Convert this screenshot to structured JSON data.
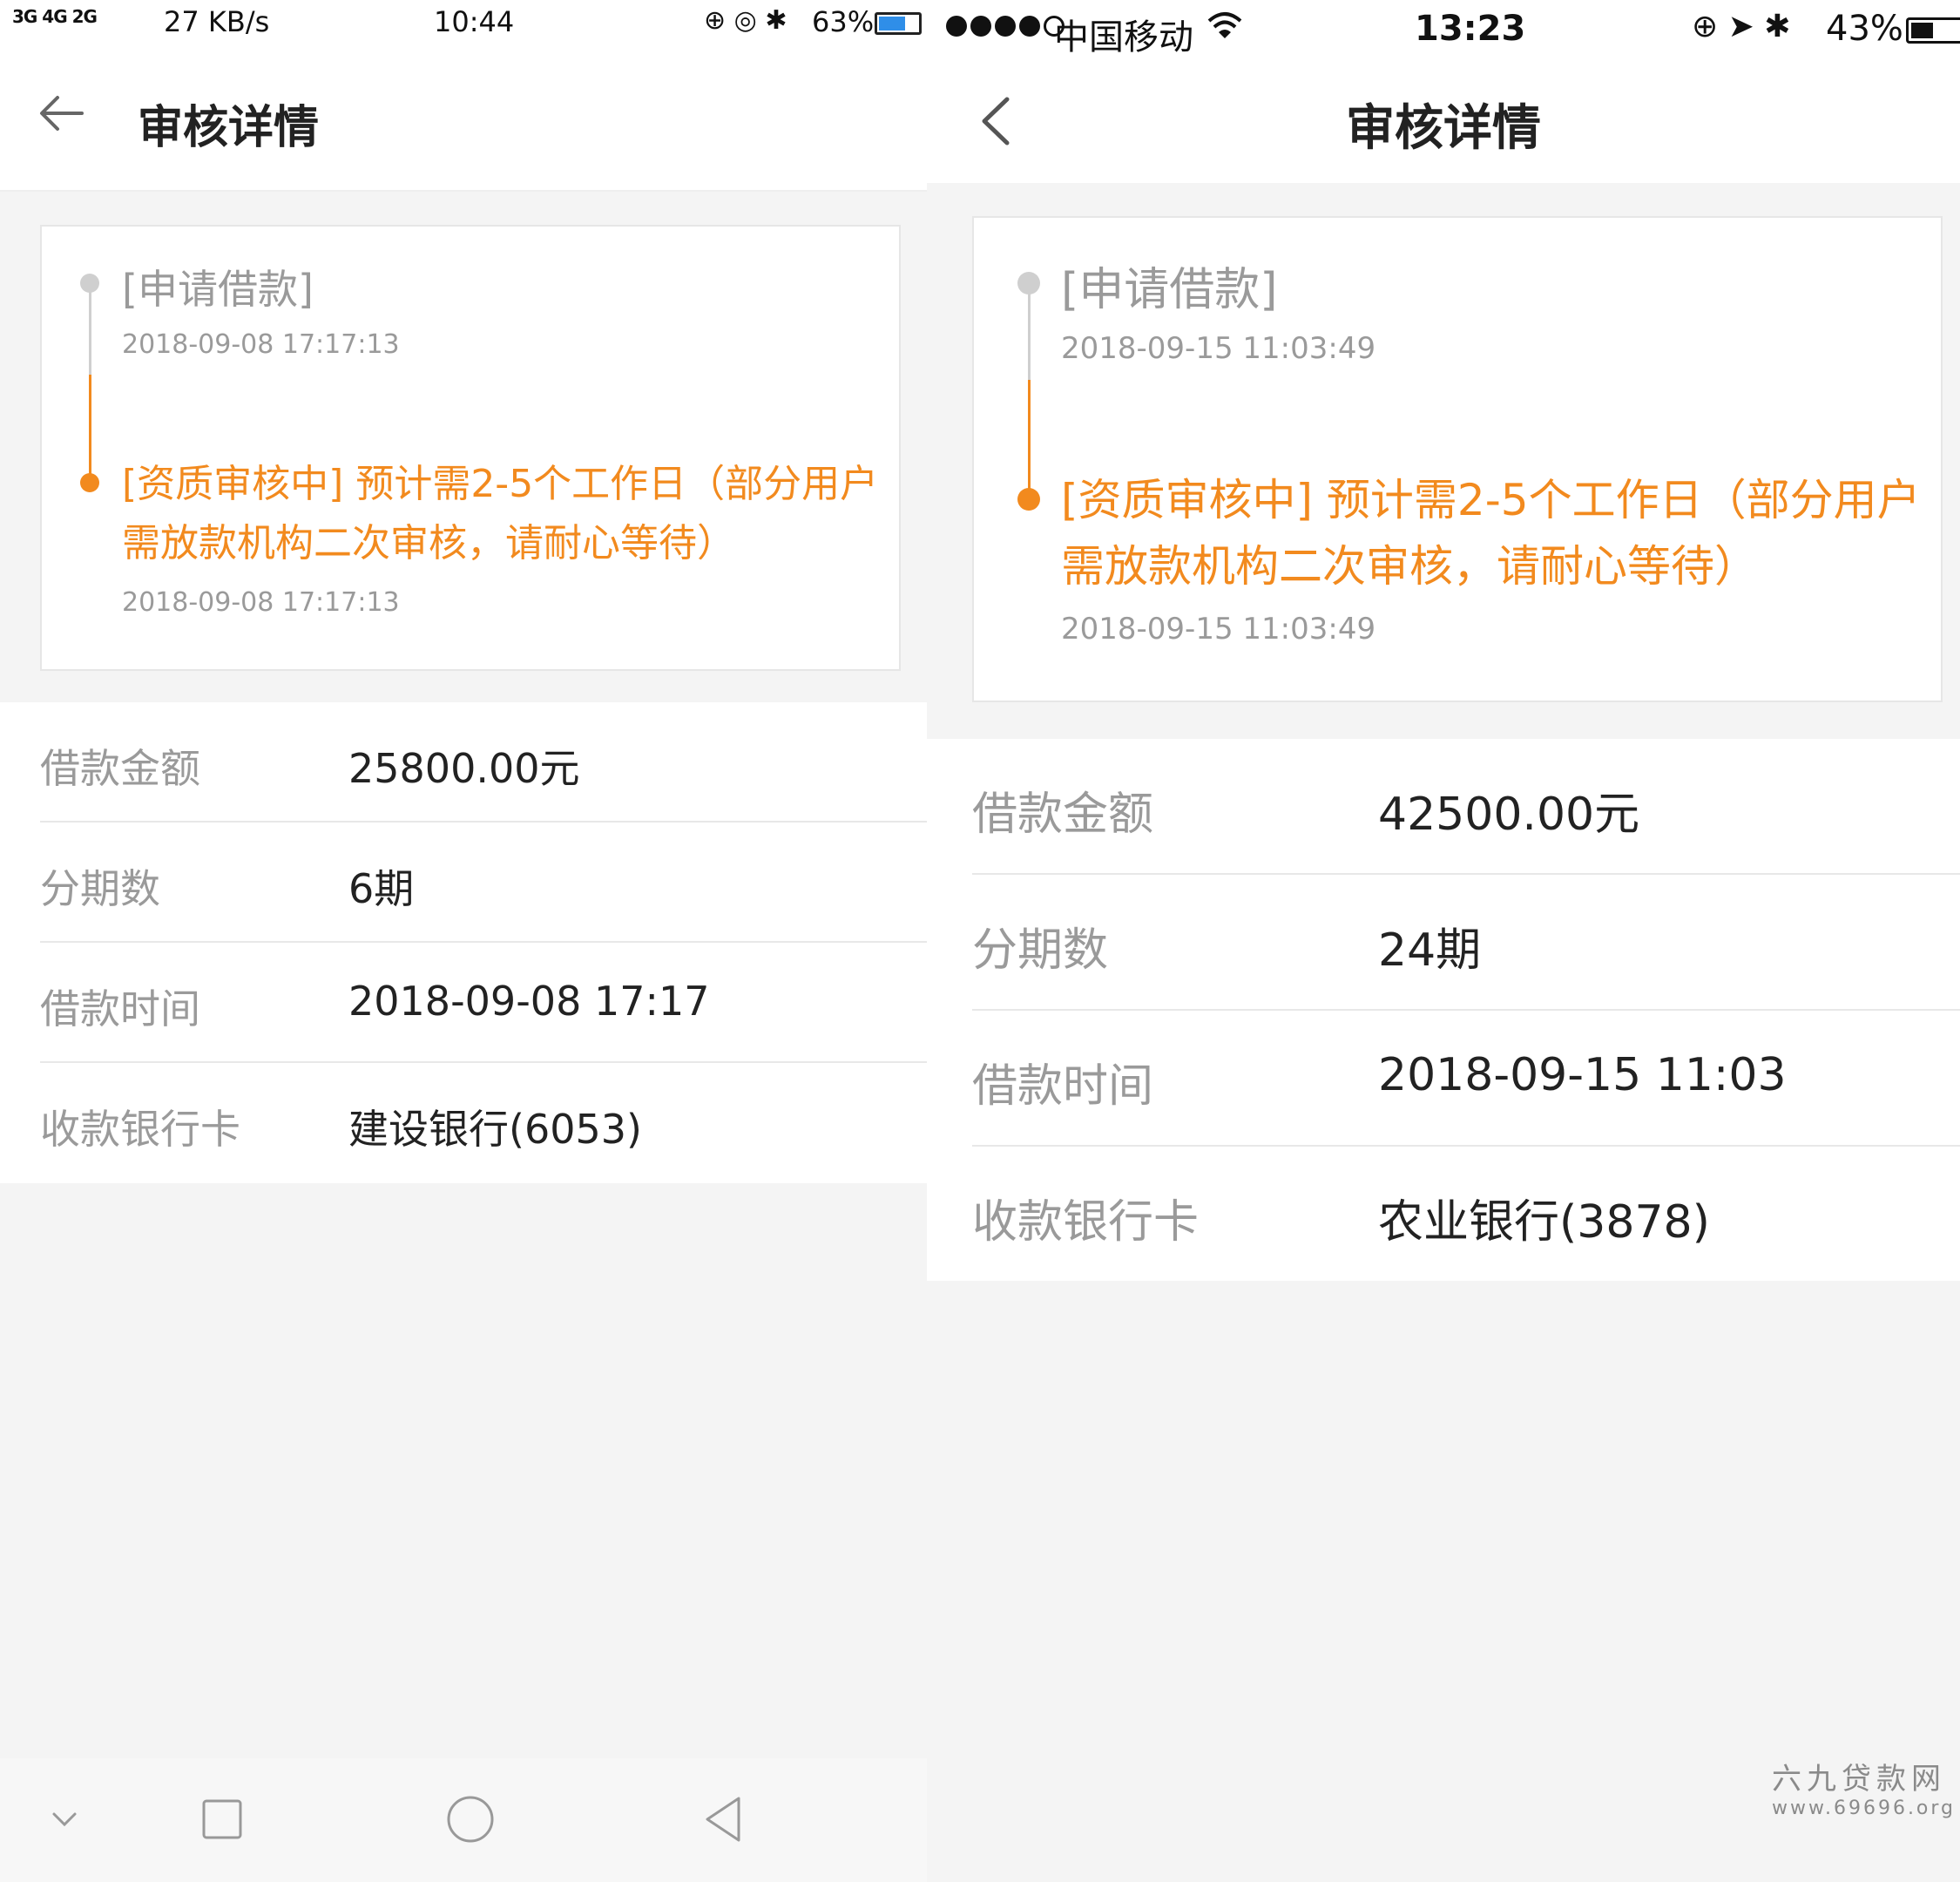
{
  "left": {
    "status": {
      "signal": "3G 4G 2G",
      "speed": "27 KB/s",
      "time": "10:44",
      "icons": "⊕ ◎ ✱",
      "battery_text": "63%",
      "battery_level": 0.63
    },
    "header": {
      "title": "审核详情"
    },
    "timeline": [
      {
        "label": "[申请借款]",
        "time": "2018-09-08 17:17:13"
      },
      {
        "label": "[资质审核中] 预计需2-5个工作日（部分用户需放款机构二次审核，请耐心等待）",
        "time": "2018-09-08 17:17:13"
      }
    ],
    "details": [
      {
        "key": "借款金额",
        "value": "25800.00元"
      },
      {
        "key": "分期数",
        "value": "6期"
      },
      {
        "key": "借款时间",
        "value": "2018-09-08 17:17"
      },
      {
        "key": "收款银行卡",
        "value": "建设银行(6053)"
      }
    ]
  },
  "right": {
    "status": {
      "carrier": "中国移动",
      "time": "13:23",
      "icons": "⊕ ➤ ✱",
      "battery_text": "43%",
      "battery_level": 0.43
    },
    "header": {
      "title": "审核详情"
    },
    "timeline": [
      {
        "label": "[申请借款]",
        "time": "2018-09-15 11:03:49"
      },
      {
        "label": "[资质审核中] 预计需2-5个工作日（部分用户需放款机构二次审核，请耐心等待）",
        "time": "2018-09-15 11:03:49"
      }
    ],
    "details": [
      {
        "key": "借款金额",
        "value": "42500.00元"
      },
      {
        "key": "分期数",
        "value": "24期"
      },
      {
        "key": "借款时间",
        "value": "2018-09-15 11:03"
      },
      {
        "key": "收款银行卡",
        "value": "农业银行(3878)"
      }
    ]
  },
  "watermark": {
    "line1": "六九贷款网",
    "line2": "www.69696.org"
  },
  "colors": {
    "accent": "#f28a1e",
    "muted": "#9a9a9a",
    "text": "#222222",
    "divider": "#e8e8e8",
    "bg": "#f4f4f4"
  }
}
